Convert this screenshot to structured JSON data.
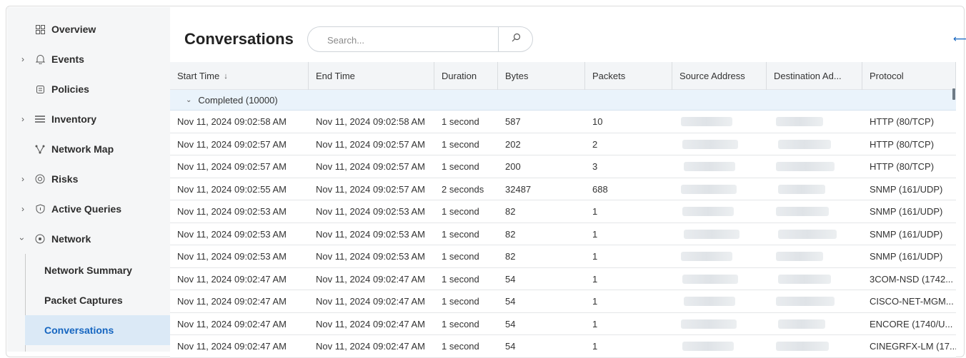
{
  "sidebar": {
    "items": [
      {
        "label": "Overview",
        "icon": "grid-icon",
        "expandable": false
      },
      {
        "label": "Events",
        "icon": "bell-icon",
        "expandable": true
      },
      {
        "label": "Policies",
        "icon": "policy-icon",
        "expandable": false
      },
      {
        "label": "Inventory",
        "icon": "list-icon",
        "expandable": true
      },
      {
        "label": "Network Map",
        "icon": "network-map-icon",
        "expandable": false
      },
      {
        "label": "Risks",
        "icon": "risk-icon",
        "expandable": true
      },
      {
        "label": "Active Queries",
        "icon": "shield-icon",
        "expandable": true
      },
      {
        "label": "Network",
        "icon": "network-icon",
        "expandable": true,
        "expanded": true
      }
    ],
    "subitems": [
      {
        "label": "Network Summary",
        "active": false
      },
      {
        "label": "Packet Captures",
        "active": false
      },
      {
        "label": "Conversations",
        "active": true
      }
    ]
  },
  "main": {
    "title": "Conversations",
    "search_placeholder": "Search...",
    "columns": [
      "Start Time",
      "End Time",
      "Duration",
      "Bytes",
      "Packets",
      "Source Address",
      "Destination Ad...",
      "Protocol"
    ],
    "sort_indicator": "↓",
    "group_label": "Completed (10000)",
    "rows": [
      [
        "Nov 11, 2024 09:02:58 AM",
        "Nov 11, 2024 09:02:58 AM",
        "1 second",
        "587",
        "10",
        "HTTP (80/TCP)"
      ],
      [
        "Nov 11, 2024 09:02:57 AM",
        "Nov 11, 2024 09:02:57 AM",
        "1 second",
        "202",
        "2",
        "HTTP (80/TCP)"
      ],
      [
        "Nov 11, 2024 09:02:57 AM",
        "Nov 11, 2024 09:02:57 AM",
        "1 second",
        "200",
        "3",
        "HTTP (80/TCP)"
      ],
      [
        "Nov 11, 2024 09:02:55 AM",
        "Nov 11, 2024 09:02:57 AM",
        "2 seconds",
        "32487",
        "688",
        "SNMP (161/UDP)"
      ],
      [
        "Nov 11, 2024 09:02:53 AM",
        "Nov 11, 2024 09:02:53 AM",
        "1 second",
        "82",
        "1",
        "SNMP (161/UDP)"
      ],
      [
        "Nov 11, 2024 09:02:53 AM",
        "Nov 11, 2024 09:02:53 AM",
        "1 second",
        "82",
        "1",
        "SNMP (161/UDP)"
      ],
      [
        "Nov 11, 2024 09:02:53 AM",
        "Nov 11, 2024 09:02:53 AM",
        "1 second",
        "82",
        "1",
        "SNMP (161/UDP)"
      ],
      [
        "Nov 11, 2024 09:02:47 AM",
        "Nov 11, 2024 09:02:47 AM",
        "1 second",
        "54",
        "1",
        "3COM-NSD (1742..."
      ],
      [
        "Nov 11, 2024 09:02:47 AM",
        "Nov 11, 2024 09:02:47 AM",
        "1 second",
        "54",
        "1",
        "CISCO-NET-MGM..."
      ],
      [
        "Nov 11, 2024 09:02:47 AM",
        "Nov 11, 2024 09:02:47 AM",
        "1 second",
        "54",
        "1",
        "ENCORE (1740/U..."
      ],
      [
        "Nov 11, 2024 09:02:47 AM",
        "Nov 11, 2024 09:02:47 AM",
        "1 second",
        "54",
        "1",
        "CINEGRFX-LM (17..."
      ]
    ]
  },
  "colors": {
    "accent": "#1565c0",
    "active_bg": "#dbe9f6",
    "sidebar_bg": "#f5f6f7",
    "header_bg": "#f3f5f7",
    "group_bg": "#eaf3fb"
  }
}
